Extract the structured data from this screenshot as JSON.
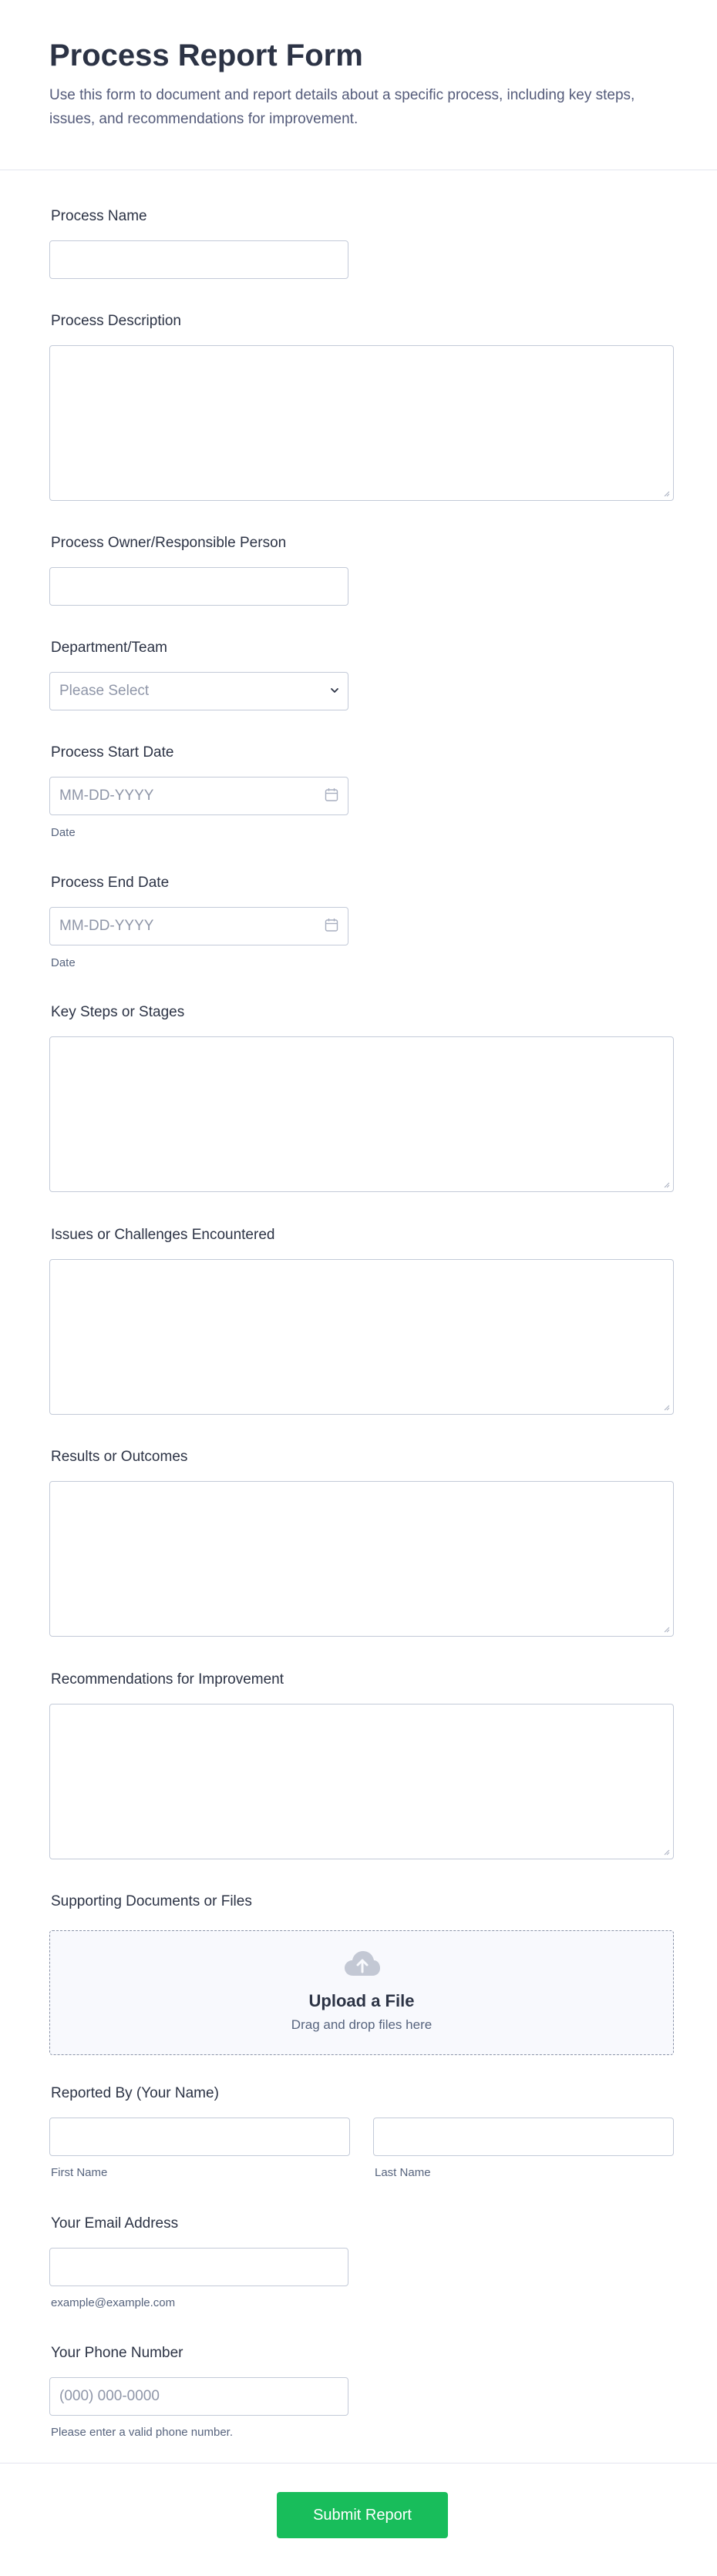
{
  "form": {
    "title": "Process Report Form",
    "subtitle": "Use this form to document and report details about a specific process, including key steps, issues, and recommendations for improvement."
  },
  "fields": {
    "process_name": {
      "label": "Process Name",
      "value": ""
    },
    "process_description": {
      "label": "Process Description",
      "value": ""
    },
    "process_owner": {
      "label": "Process Owner/Responsible Person",
      "value": ""
    },
    "department": {
      "label": "Department/Team",
      "placeholder": "Please Select"
    },
    "start_date": {
      "label": "Process Start Date",
      "placeholder": "MM-DD-YYYY",
      "sublabel": "Date"
    },
    "end_date": {
      "label": "Process End Date",
      "placeholder": "MM-DD-YYYY",
      "sublabel": "Date"
    },
    "key_steps": {
      "label": "Key Steps or Stages",
      "value": ""
    },
    "issues": {
      "label": "Issues or Challenges Encountered",
      "value": ""
    },
    "results": {
      "label": "Results or Outcomes",
      "value": ""
    },
    "recommendations": {
      "label": "Recommendations for Improvement",
      "value": ""
    },
    "documents": {
      "label": "Supporting Documents or Files",
      "upload_title": "Upload a File",
      "upload_subtitle": "Drag and drop files here",
      "icon": "upload-cloud-icon"
    },
    "reported_by": {
      "label": "Reported By (Your Name)",
      "first_sublabel": "First Name",
      "last_sublabel": "Last Name"
    },
    "email": {
      "label": "Your Email Address",
      "sublabel": "example@example.com"
    },
    "phone": {
      "label": "Your Phone Number",
      "placeholder": "(000) 000-0000",
      "sublabel": "Please enter a valid phone number."
    }
  },
  "submit": {
    "label": "Submit Report"
  },
  "colors": {
    "accent": "#18bd5b",
    "border": "#c3cad8",
    "text": "#2c3345",
    "muted": "#57647e"
  }
}
